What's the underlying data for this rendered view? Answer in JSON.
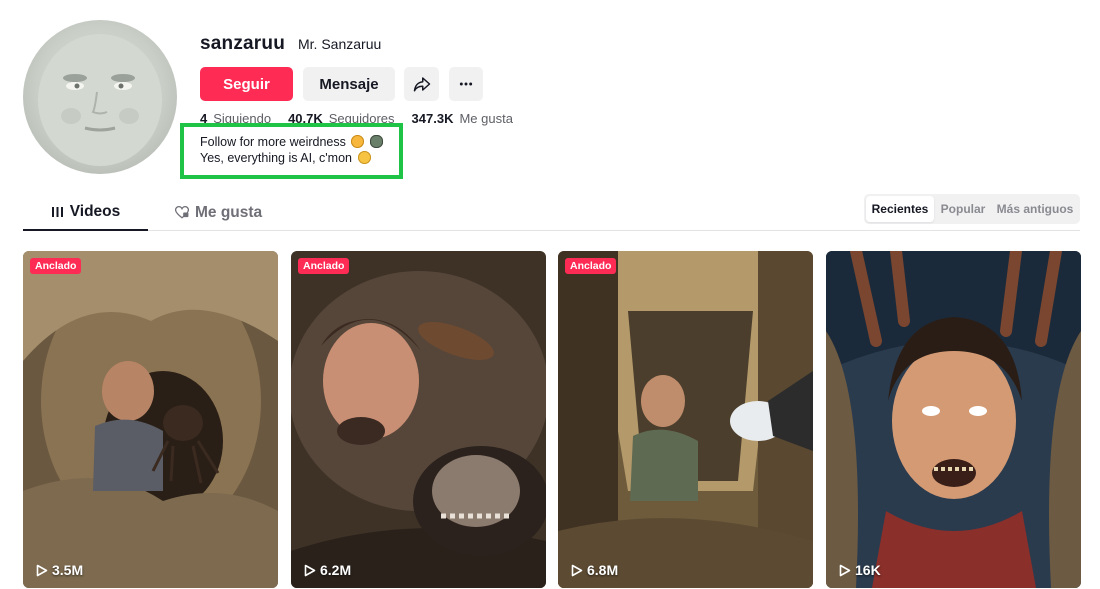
{
  "profile": {
    "username": "sanzaruu",
    "nickname": "Mr. Sanzaruu",
    "avatar_icon": "moon-face-avatar"
  },
  "actions": {
    "follow_label": "Seguir",
    "message_label": "Mensaje",
    "share_icon": "share-arrow-icon",
    "more_icon": "more-dots-icon"
  },
  "stats": {
    "following_count": "4",
    "following_label": "Siguiendo",
    "followers_count": "40.7K",
    "followers_label": "Seguidores",
    "likes_count": "347.3K",
    "likes_label": "Me gusta"
  },
  "bio": {
    "line1": "Follow for more weirdness",
    "line2": "Yes, everything is AI, c'mon"
  },
  "tabs": [
    {
      "label": "Videos",
      "icon": "grid-bars-icon",
      "active": true
    },
    {
      "label": "Me gusta",
      "icon": "heart-lock-icon",
      "active": false
    }
  ],
  "sort": [
    {
      "label": "Recientes",
      "active": true
    },
    {
      "label": "Popular",
      "active": false
    },
    {
      "label": "Más antiguos",
      "active": false
    }
  ],
  "videos": [
    {
      "pinned": true,
      "pin_label": "Anclado",
      "views": "3.5M"
    },
    {
      "pinned": true,
      "pin_label": "Anclado",
      "views": "6.2M"
    },
    {
      "pinned": true,
      "pin_label": "Anclado",
      "views": "6.8M"
    },
    {
      "pinned": false,
      "pin_label": "",
      "views": "16K"
    }
  ],
  "colors": {
    "accent": "#fe2c55",
    "highlight_box": "#1fc447",
    "button_gray": "#f1f1f2"
  }
}
